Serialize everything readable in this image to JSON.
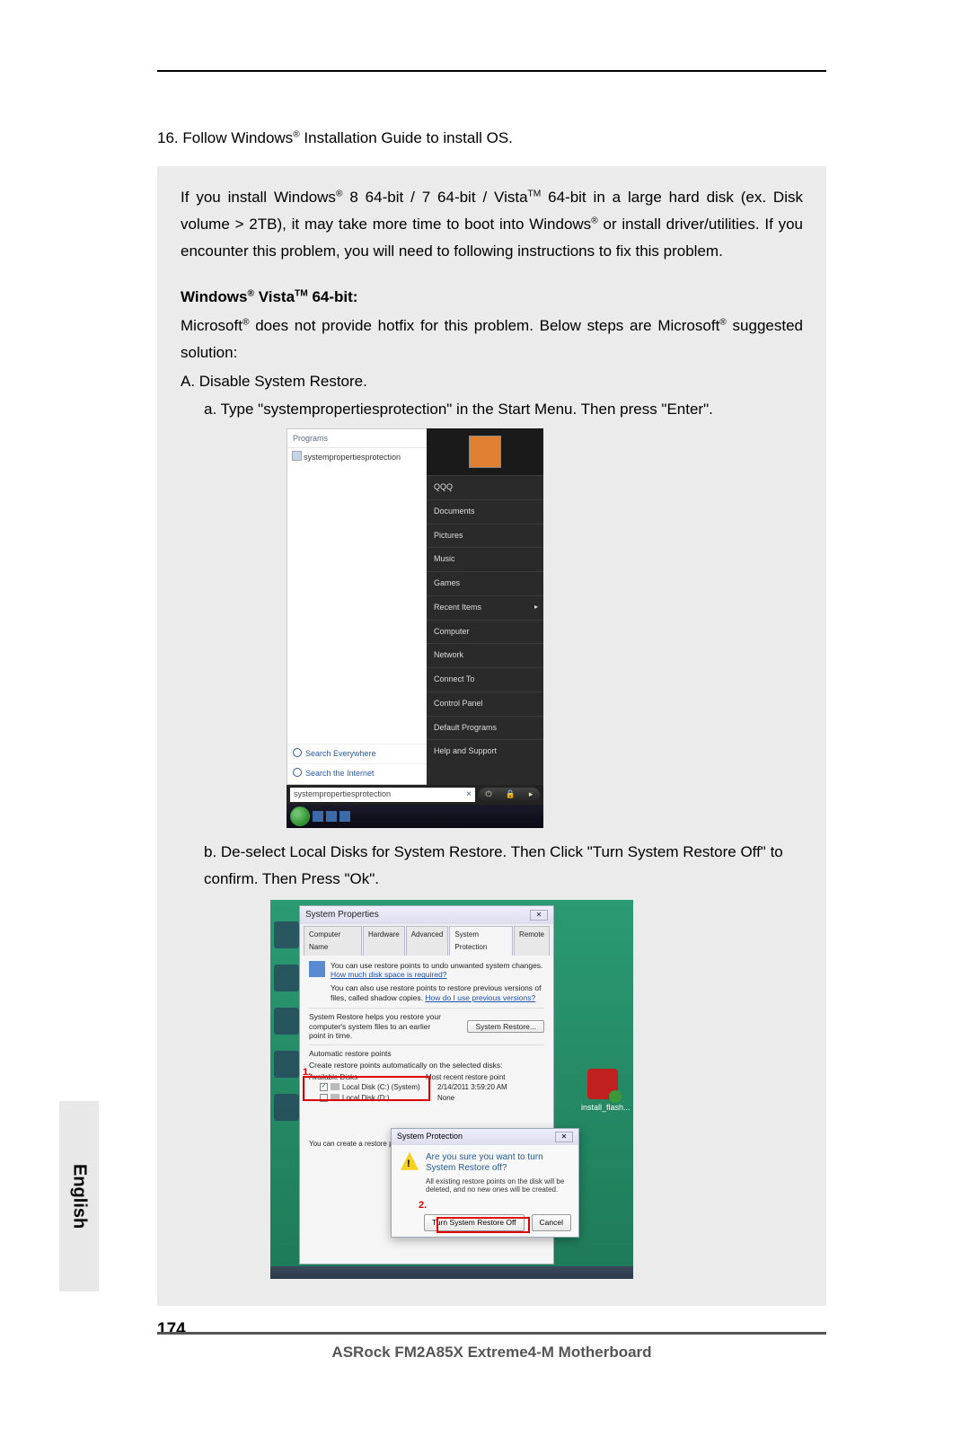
{
  "page": {
    "number": "174",
    "language": "English",
    "footer": "ASRock  FM2A85X Extreme4-M  Motherboard"
  },
  "step16": {
    "num": "16.",
    "pre": "Follow Windows",
    "post": " Installation Guide to install OS."
  },
  "note": {
    "intro1a": "If you install Windows",
    "intro1b": " 8 64-bit / 7 64-bit / Vista",
    "intro1c": " 64-bit in a large hard disk (ex. Disk volume > 2TB), it may take more time to boot into Windows",
    "intro1d": " or install driver/utilities. If you encounter this problem, you will need to following instructions to fix this problem.",
    "heading_a": "Windows",
    "heading_b": " Vista",
    "heading_c": " 64-bit:",
    "ms1": "Microsoft",
    "ms2": " does not provide hotfix for this problem. Below steps are Microsoft",
    "ms3": " suggested solution:",
    "A": "A. Disable System Restore.",
    "a": "a. Type \"systempropertiesprotection\" in the Start Menu. Then press \"Enter\".",
    "b": "b. De-select Local Disks for System Restore. Then Click \"Turn System Restore Off\" to confirm. Then Press \"Ok\"."
  },
  "startmenu": {
    "programs_label": "Programs",
    "program_item": "systempropertiesprotection",
    "search_everywhere": "Search Everywhere",
    "search_internet": "Search the Internet",
    "username": "QQQ",
    "items": [
      "Documents",
      "Pictures",
      "Music",
      "Games",
      "Recent Items",
      "Computer",
      "Network",
      "Connect To",
      "Control Panel",
      "Default Programs",
      "Help and Support"
    ],
    "search_value": "systempropertiesprotection",
    "power_sleep": "⏻",
    "power_lock": "🔒",
    "power_arrow": "▸"
  },
  "sysprops": {
    "title": "System Properties",
    "close": "✕",
    "tabs": [
      "Computer Name",
      "Hardware",
      "Advanced",
      "System Protection",
      "Remote"
    ],
    "desc1": "You can use restore points to undo unwanted system changes. ",
    "link1": "How much disk space is required?",
    "desc2": "You can also use restore points to restore previous versions of files, called shadow copies. ",
    "link2": "How do I use previous versions?",
    "restore_help": "System Restore helps you restore your computer's system files to an earlier point in time.",
    "restore_btn": "System Restore...",
    "auto_label": "Automatic restore points",
    "create_label": "Create restore points automatically on the selected disks:",
    "col_disk": "Available Disks",
    "col_recent": "Most recent restore point",
    "row1_disk": "Local Disk (C:) (System)",
    "row1_date": "2/14/2011 3:59:20 AM",
    "row2_disk": "Local Disk (D:)",
    "row2_date": "None",
    "create_note": "You can create a restore point right now for the disks selected above.",
    "num1": "1.",
    "flash_label": "install_flash..."
  },
  "confirm": {
    "title": "System Protection",
    "close": "✕",
    "question": "Are you sure you want to turn System Restore off?",
    "sub": "All existing restore points on the disk will be deleted, and no new ones will be created.",
    "btn_off": "Turn System Restore Off",
    "btn_cancel": "Cancel",
    "num2": "2."
  }
}
